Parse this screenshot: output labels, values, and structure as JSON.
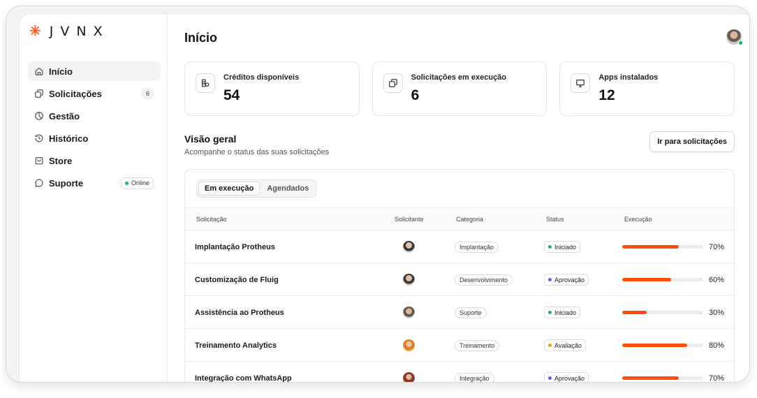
{
  "brand": {
    "logo_text": "JVNX",
    "accent": "#ff5a1f"
  },
  "sidebar": {
    "items": [
      {
        "label": "Início",
        "icon": "home-icon",
        "active": true
      },
      {
        "label": "Solicitações",
        "icon": "copy-icon",
        "badge": "6"
      },
      {
        "label": "Gestão",
        "icon": "pie-chart-icon"
      },
      {
        "label": "Histórico",
        "icon": "history-icon"
      },
      {
        "label": "Store",
        "icon": "store-icon"
      },
      {
        "label": "Suporte",
        "icon": "chat-icon",
        "status_badge": "Online",
        "status_color": "#21b36b"
      }
    ]
  },
  "header": {
    "title": "Início"
  },
  "stats": [
    {
      "label": "Créditos disponíveis",
      "value": "54",
      "icon": "ledger-icon"
    },
    {
      "label": "Solicitações em execução",
      "value": "6",
      "icon": "copy-icon"
    },
    {
      "label": "Apps instalados",
      "value": "12",
      "icon": "monitor-icon"
    }
  ],
  "overview": {
    "title": "Visão geral",
    "subtitle": "Acompanhe o status das suas solicitações",
    "button_label": "Ir para solicitações"
  },
  "table": {
    "tabs": [
      "Em execução",
      "Agendados"
    ],
    "active_tab": 0,
    "columns": [
      "Solicitação",
      "Solicitante",
      "Categoria",
      "Status",
      "Execução"
    ],
    "rows": [
      {
        "name": "Implantação Protheus",
        "category": "Implantação",
        "status": "Iniciado",
        "status_color": "#21b36b",
        "progress": 70,
        "progress_label": "70%"
      },
      {
        "name": "Customização de Fluig",
        "category": "Desenvolvimento",
        "status": "Aprovação",
        "status_color": "#6d5cf0",
        "progress": 60,
        "progress_label": "60%"
      },
      {
        "name": "Assistência ao Protheus",
        "category": "Suporte",
        "status": "Iniciado",
        "status_color": "#21b36b",
        "progress": 30,
        "progress_label": "30%"
      },
      {
        "name": "Treinamento Analytics",
        "category": "Treinamento",
        "status": "Avaliação",
        "status_color": "#f59e0b",
        "progress": 80,
        "progress_label": "80%"
      },
      {
        "name": "Integração com WhatsApp",
        "category": "Integração",
        "status": "Aprovação",
        "status_color": "#6d5cf0",
        "progress": 70,
        "progress_label": "70%"
      }
    ]
  }
}
